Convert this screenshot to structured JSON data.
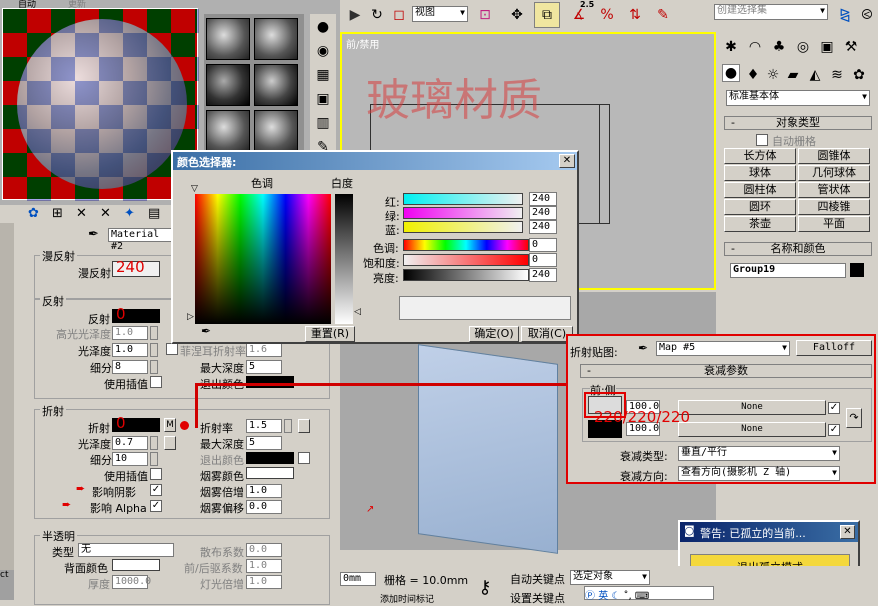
{
  "material_editor": {
    "top_labels": [
      "自动",
      "更新"
    ],
    "material_name": "Material #2",
    "black_suffix": "黑",
    "degree_label": "度",
    "diffuse": {
      "title": "漫反射",
      "label": "漫反射",
      "value": "240"
    },
    "reflect": {
      "title": "反射",
      "reflect_label": "反射",
      "reflect_value": "0",
      "hilight_label": "高光光泽度",
      "hilight_value": "1.0",
      "gloss_label": "光泽度",
      "gloss_value": "1.0",
      "subdiv_label": "细分",
      "subdiv_value": "8",
      "interp_label": "使用插值",
      "max_depth_label": "最大深度",
      "max_depth_value": "5",
      "exit_color_label": "退出颜色",
      "fresnel_label": "菲涅耳折射率",
      "fresnel_value": "1.6"
    },
    "refract": {
      "title": "折射",
      "refract_label": "折射",
      "refract_value": "0",
      "m_label": "M",
      "ior_label": "折射率",
      "ior_value": "1.5",
      "gloss_label": "光泽度",
      "gloss_value": "0.7",
      "max_depth_label": "最大深度",
      "max_depth_value": "5",
      "subdiv_label": "细分",
      "subdiv_value": "10",
      "exit_color_label": "退出颜色",
      "interp_label": "使用插值",
      "fog_color_label": "烟雾颜色",
      "shadow_label": "影响阴影",
      "fog_mult_label": "烟雾倍增",
      "fog_mult_value": "1.0",
      "alpha_label": "影响 Alpha",
      "fog_bias_label": "烟雾偏移",
      "fog_bias_value": "0.0"
    },
    "translucent": {
      "title": "半透明",
      "type_label": "类型",
      "type_value": "无",
      "scatter_label": "散布系数",
      "scatter_value": "0.0",
      "back_color_label": "背面颜色",
      "fb_label": "前/后驱系数",
      "fb_value": "1.0",
      "thick_label": "厚度",
      "thick_value": "1000.0",
      "light_label": "灯光倍增",
      "light_value": "1.0"
    }
  },
  "toolbar": {
    "view_select": "视图",
    "selection_set": "创建选择集",
    "snap_25": "2.5"
  },
  "viewport": {
    "label": "前/禁用",
    "watermark": "玻璃材质"
  },
  "color_picker": {
    "title": "颜色选择器:",
    "hue_label": "色调",
    "whiteness_label": "白度",
    "black_label": "黑",
    "degree_label": "度",
    "red_label": "红:",
    "red_value": "240",
    "green_label": "绿:",
    "green_value": "240",
    "blue_label": "蓝:",
    "blue_value": "240",
    "hue_value_label": "色调:",
    "hue_value": "0",
    "sat_label": "饱和度:",
    "sat_value": "0",
    "value_label": "亮度:",
    "value_value": "240",
    "reset_label": "重置(R)",
    "ok_label": "确定(O)",
    "cancel_label": "取消(C)"
  },
  "falloff": {
    "refract_map_label": "折射贴图:",
    "map_value": "Map #5",
    "falloff_button": "Falloff",
    "params_title": "衰减参数",
    "front_side_label": "前:侧",
    "value1": "100.0",
    "value2": "100.0",
    "none1": "None",
    "none2": "None",
    "annotation": "220/220/220",
    "falloff_type_label": "衰减类型:",
    "falloff_type_value": "垂直/平行",
    "falloff_dir_label": "衰减方向:",
    "falloff_dir_value": "查看方向(摄影机 Z 轴)"
  },
  "command_panel": {
    "dropdown": "标准基本体",
    "object_type_title": "对象类型",
    "autogrid_label": "自动栅格",
    "buttons": [
      "长方体",
      "圆锥体",
      "球体",
      "几何球体",
      "圆柱体",
      "管状体",
      "圆环",
      "四棱锥",
      "茶壶",
      "平面"
    ],
    "name_color_title": "名称和颜色",
    "name_value": "Group19"
  },
  "warning": {
    "title": "警告: 已孤立的当前...",
    "exit_button": "退出孤立模式"
  },
  "status": {
    "zoom_value": "0mm",
    "grid_label": "栅格 = 10.0mm",
    "auto_key": "自动关键点",
    "set_key": "设置关键点",
    "selected": "选定对象",
    "add_time_tag": "添加时间标记",
    "ime_label": "英"
  }
}
